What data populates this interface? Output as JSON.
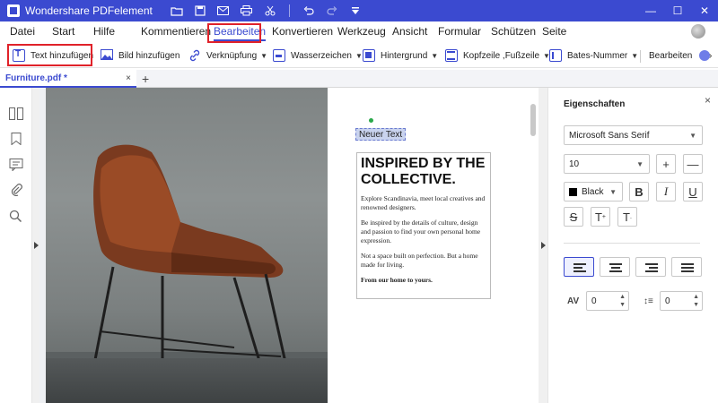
{
  "titlebar": {
    "app_title": "Wondershare PDFelement",
    "icons": [
      "folder-icon",
      "save-icon",
      "mail-icon",
      "print-icon",
      "scissors-icon",
      "undo-icon",
      "redo-icon",
      "quick-access-icon"
    ],
    "window_controls": [
      "minimize-icon",
      "maximize-icon",
      "close-icon"
    ],
    "accent_color": "#3b4ad0"
  },
  "menu": {
    "items": [
      "Datei",
      "Start",
      "Hilfe",
      "Kommentieren",
      "Bearbeiten",
      "Konvertieren",
      "Werkzeug",
      "Ansicht",
      "Formular",
      "Schützen",
      "Seite"
    ],
    "active": "Bearbeiten"
  },
  "toolbar": {
    "add_text": "Text hinzufügen",
    "add_image": "Bild hinzufügen",
    "link": "Verknüpfung",
    "watermark": "Wasserzeichen",
    "background": "Hintergrund",
    "header_footer": "Kopfzeile ,Fußzeile",
    "bates": "Bates-Nummer",
    "edit": "Bearbeiten",
    "more_icon": "chevron-right-icon",
    "highlight_color": "#e0222a"
  },
  "tabs": {
    "document": "Furniture.pdf *",
    "close": "×",
    "add": "+"
  },
  "document": {
    "new_text": "Neuer Text",
    "heading": "INSPIRED BY THE COLLECTIVE.",
    "paragraphs": [
      "Explore Scandinavia, meet local creatives and renowned designers.",
      "Be inspired by the details of culture, design and passion to find your own personal home expression.",
      "Not a space built on perfection. But a home made for living."
    ],
    "closing": "From our home to yours."
  },
  "properties": {
    "title": "Eigenschaften",
    "close": "×",
    "font_family": "Microsoft Sans Serif",
    "font_size": "10",
    "color_name": "Black",
    "color_value": "#000000",
    "increase": "+",
    "decrease": "—",
    "bold": "B",
    "italic": "I",
    "underline": "U",
    "strike": "S",
    "superscript": "T",
    "subscript": "T",
    "char_spacing": "0",
    "line_spacing": "0",
    "alignment_active": "left"
  }
}
